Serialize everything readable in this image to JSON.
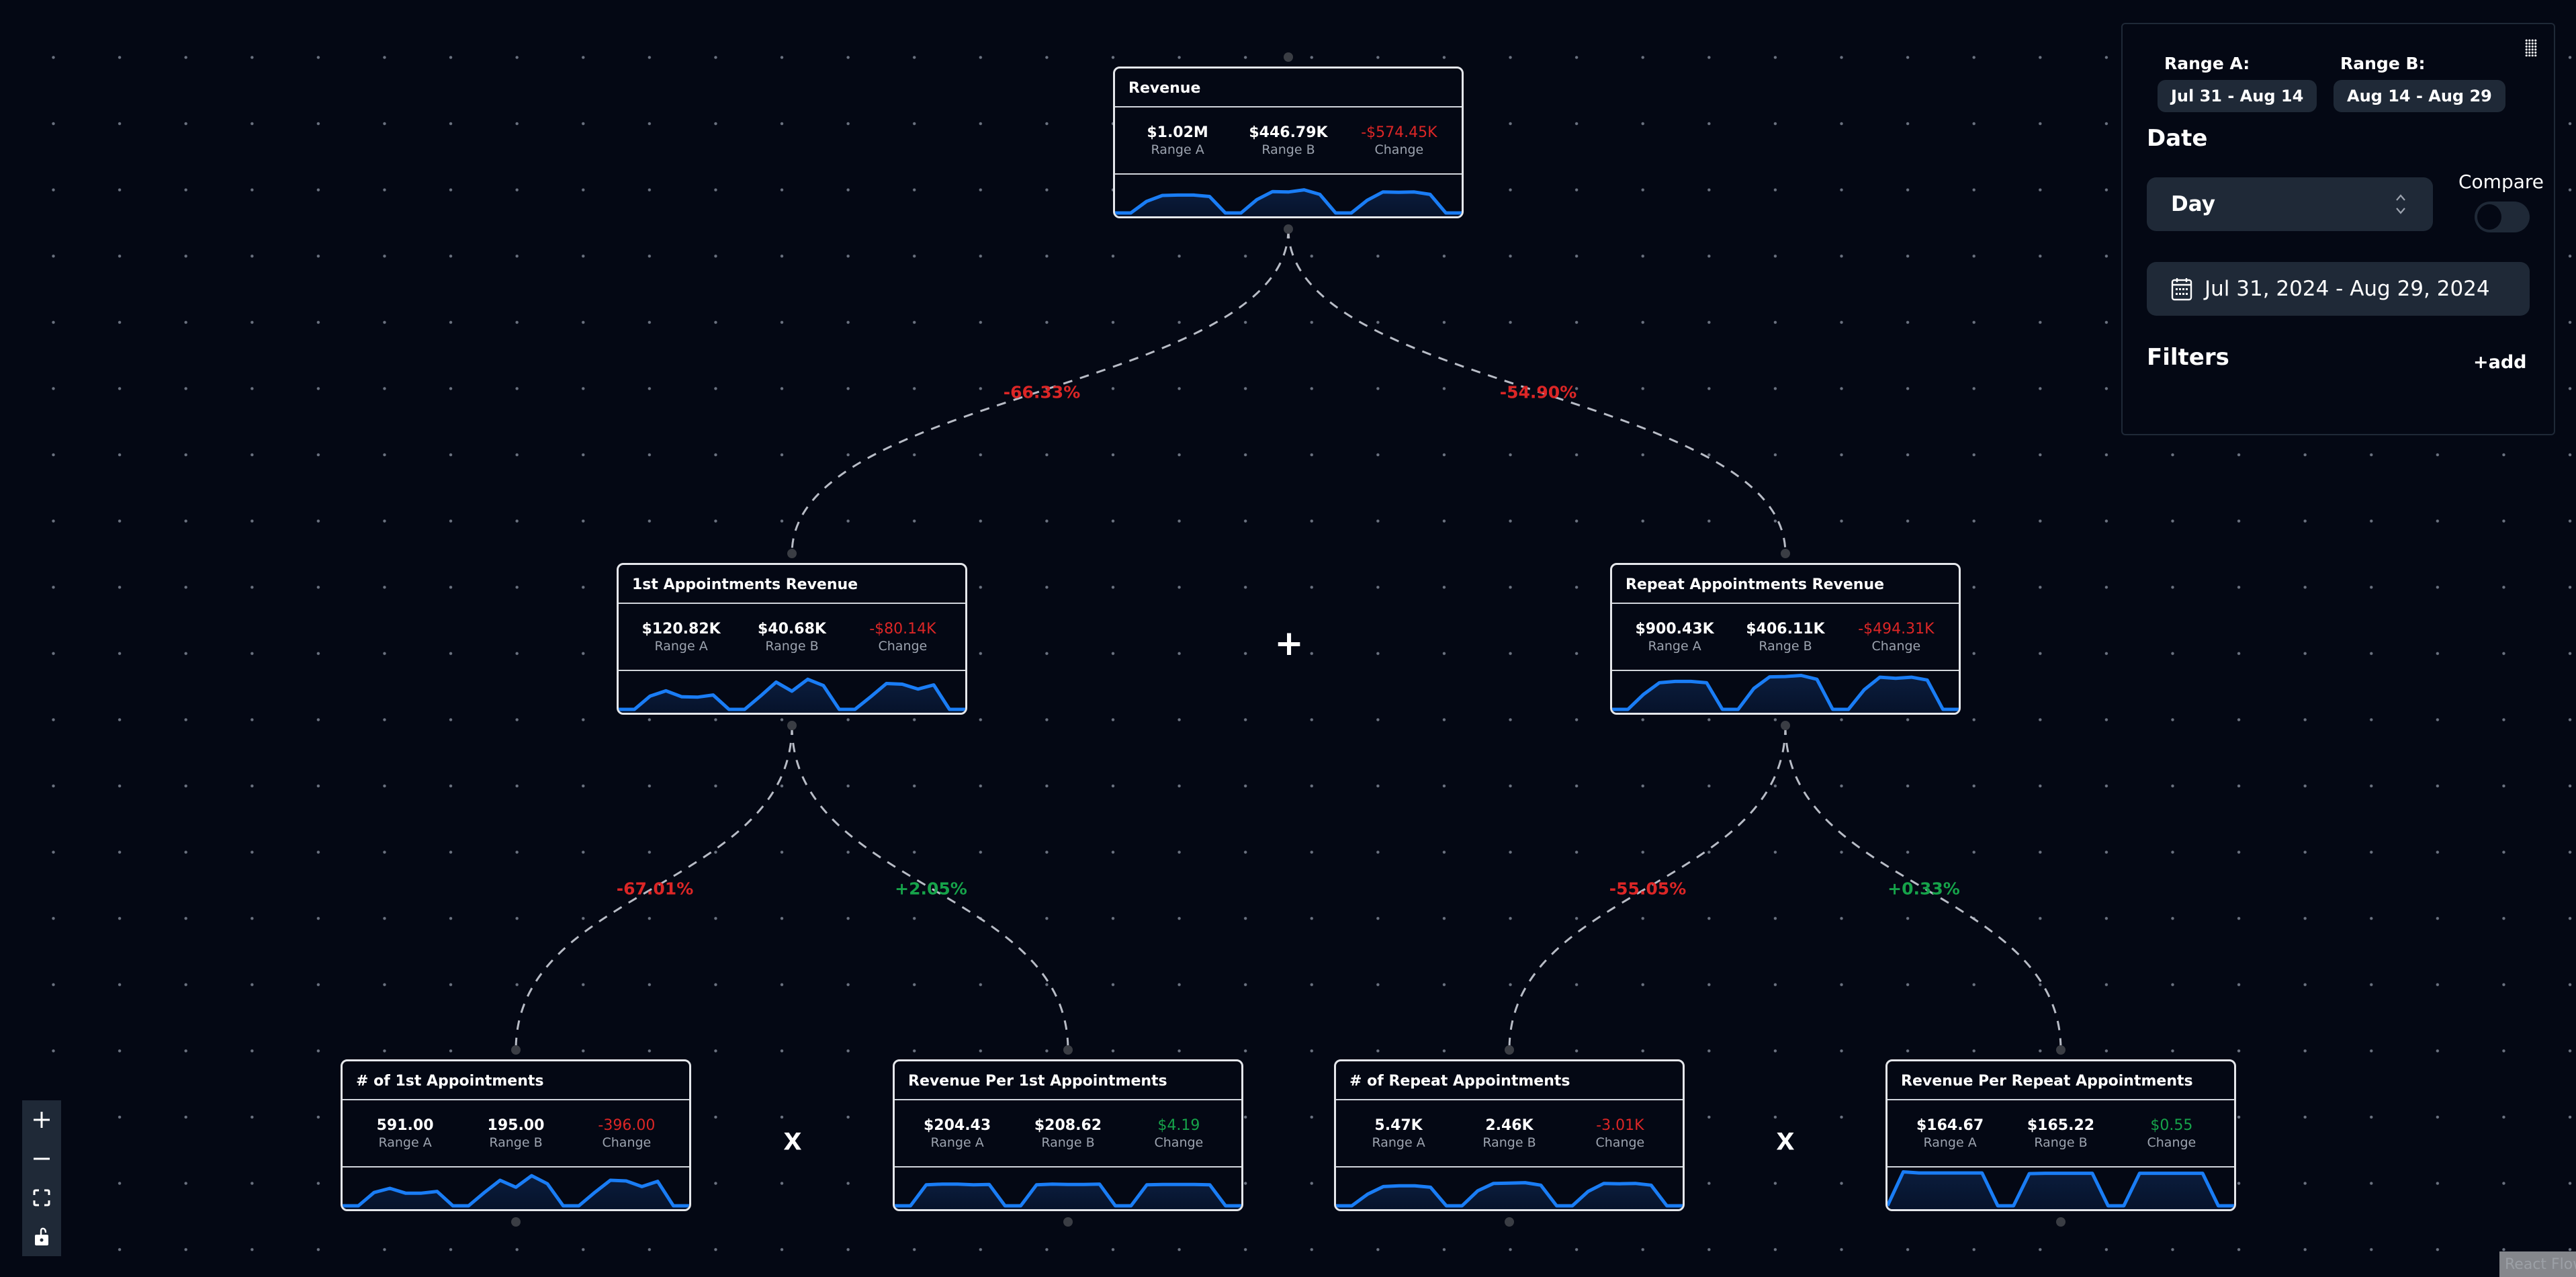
{
  "colors": {
    "background": "#040814",
    "negative": "#dc2626",
    "positive": "#16a34a",
    "sparkline": "#1a7df5",
    "panel_surface": "#1f2937"
  },
  "nodes": [
    {
      "id": "revenue",
      "title": "Revenue",
      "range_a": "$1.02M",
      "range_b": "$446.79K",
      "change": "-$574.45K",
      "change_sign": "negative",
      "labels": {
        "a": "Range A",
        "b": "Range B",
        "change": "Change"
      },
      "sparkline": [
        2,
        2,
        35,
        52,
        53,
        53,
        49,
        2,
        2,
        40,
        63,
        62,
        68,
        55,
        2,
        2,
        38,
        62,
        61,
        62,
        55,
        2,
        2
      ]
    },
    {
      "id": "first-appointments-revenue",
      "title": "1st Appointments Revenue",
      "range_a": "$120.82K",
      "range_b": "$40.68K",
      "change": "-$80.14K",
      "change_sign": "negative",
      "labels": {
        "a": "Range A",
        "b": "Range B",
        "change": "Change"
      },
      "sparkline": [
        2,
        2,
        40,
        55,
        38,
        37,
        43,
        2,
        2,
        40,
        80,
        54,
        88,
        70,
        2,
        2,
        38,
        76,
        74,
        60,
        72,
        2,
        2
      ]
    },
    {
      "id": "repeat-appointments-revenue",
      "title": "Repeat Appointments Revenue",
      "range_a": "$900.43K",
      "range_b": "$406.11K",
      "change": "-$494.31K",
      "change_sign": "negative",
      "labels": {
        "a": "Range A",
        "b": "Range B",
        "change": "Change"
      },
      "sparkline": [
        2,
        2,
        45,
        78,
        82,
        82,
        78,
        2,
        2,
        62,
        95,
        96,
        99,
        88,
        2,
        2,
        58,
        94,
        91,
        94,
        86,
        2,
        2
      ]
    },
    {
      "id": "num-first-appointments",
      "title": "# of 1st Appointments",
      "range_a": "591.00",
      "range_b": "195.00",
      "change": "-396.00",
      "change_sign": "negative",
      "labels": {
        "a": "Range A",
        "b": "Range B",
        "change": "Change"
      },
      "sparkline": [
        2,
        2,
        40,
        52,
        38,
        38,
        43,
        2,
        2,
        40,
        75,
        55,
        88,
        65,
        2,
        2,
        40,
        75,
        73,
        57,
        72,
        2,
        2
      ]
    },
    {
      "id": "revenue-per-first-appointment",
      "title": "Revenue Per 1st Appointments",
      "range_a": "$204.43",
      "range_b": "$208.62",
      "change": "$4.19",
      "change_sign": "positive",
      "labels": {
        "a": "Range A",
        "b": "Range B",
        "change": "Change"
      },
      "sparkline": [
        2,
        2,
        62,
        64,
        64,
        62,
        63,
        2,
        2,
        62,
        64,
        63,
        63,
        64,
        2,
        2,
        62,
        63,
        63,
        63,
        62,
        2,
        2
      ]
    },
    {
      "id": "num-repeat-appointments",
      "title": "# of Repeat Appointments",
      "range_a": "5.47K",
      "range_b": "2.46K",
      "change": "-3.01K",
      "change_sign": "negative",
      "labels": {
        "a": "Range A",
        "b": "Range B",
        "change": "Change"
      },
      "sparkline": [
        2,
        2,
        35,
        57,
        59,
        59,
        55,
        2,
        2,
        45,
        66,
        67,
        68,
        61,
        2,
        2,
        43,
        66,
        65,
        66,
        61,
        2,
        2
      ]
    },
    {
      "id": "revenue-per-repeat-appointment",
      "title": "Revenue Per Repeat Appointments",
      "range_a": "$164.67",
      "range_b": "$165.22",
      "change": "$0.55",
      "change_sign": "positive",
      "labels": {
        "a": "Range A",
        "b": "Range B",
        "change": "Change"
      },
      "sparkline": [
        2,
        99,
        96,
        96,
        96,
        96,
        96,
        2,
        2,
        94,
        95,
        95,
        95,
        95,
        2,
        2,
        95,
        95,
        95,
        95,
        95,
        2,
        2
      ]
    }
  ],
  "edges": [
    {
      "from": "revenue",
      "to": "first-appointments-revenue",
      "label": "-66.33%",
      "sign": "negative"
    },
    {
      "from": "revenue",
      "to": "repeat-appointments-revenue",
      "label": "-54.90%",
      "sign": "negative"
    },
    {
      "from": "first-appointments-revenue",
      "to": "num-first-appointments",
      "label": "-67.01%",
      "sign": "negative"
    },
    {
      "from": "first-appointments-revenue",
      "to": "revenue-per-first-appointment",
      "label": "+2.05%",
      "sign": "positive"
    },
    {
      "from": "repeat-appointments-revenue",
      "to": "num-repeat-appointments",
      "label": "-55.05%",
      "sign": "negative"
    },
    {
      "from": "repeat-appointments-revenue",
      "to": "revenue-per-repeat-appointment",
      "label": "+0.33%",
      "sign": "positive"
    }
  ],
  "operators": {
    "sum": "+",
    "product_left": "x",
    "product_right": "x"
  },
  "controls": {
    "zoom_in": "zoom-in-icon",
    "zoom_out": "zoom-out-icon",
    "fit_view": "fit-view-icon",
    "lock": "unlock-icon"
  },
  "attribution": "React Flow",
  "panel": {
    "range_a_label": "Range A:",
    "range_a_value": "Jul 31 - Aug 14",
    "range_b_label": "Range B:",
    "range_b_value": "Aug 14 - Aug 29",
    "date_title": "Date",
    "granularity": "Day",
    "compare_label": "Compare",
    "compare_enabled": false,
    "date_range": "Jul 31, 2024 - Aug 29, 2024",
    "filters_title": "Filters",
    "add_filter_label": "+add"
  }
}
